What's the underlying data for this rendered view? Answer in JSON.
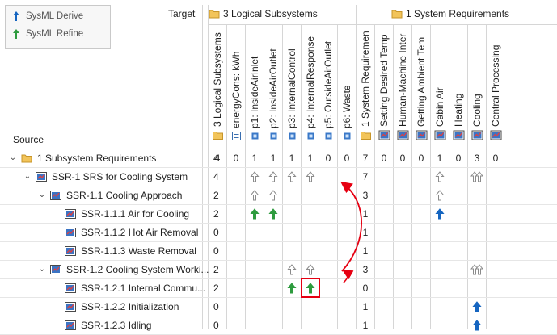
{
  "legend": {
    "items": [
      {
        "label": "SysML Derive",
        "color": "#1565c0"
      },
      {
        "label": "SysML Refine",
        "color": "#2e9b3e"
      }
    ]
  },
  "corner": {
    "target_label": "Target",
    "source_label": "Source"
  },
  "column_groups": [
    {
      "label": "3 Logical Subsystems"
    },
    {
      "label": "1 System Requirements"
    }
  ],
  "columns": [
    {
      "label": "3 Logical Subsystems",
      "icon": "folder-icon"
    },
    {
      "label": "energyCons: kWh",
      "icon": "property-icon"
    },
    {
      "label": "p1: InsideAirInlet",
      "icon": "port-icon"
    },
    {
      "label": "p2: InsideAirOutlet",
      "icon": "port-icon"
    },
    {
      "label": "p3: InternalControl",
      "icon": "port-icon"
    },
    {
      "label": "p4: InternalResponse",
      "icon": "port-icon"
    },
    {
      "label": "p5: OutsideAirOutlet",
      "icon": "port-icon"
    },
    {
      "label": "p6: Waste",
      "icon": "port-icon"
    },
    {
      "label": "1 System Requiremen",
      "icon": "folder-icon"
    },
    {
      "label": "Setting Desired Temp",
      "icon": "requirement-icon"
    },
    {
      "label": "Human-Machine Inter",
      "icon": "requirement-icon"
    },
    {
      "label": "Getting Ambient Tem",
      "icon": "requirement-icon"
    },
    {
      "label": "Cabin Air",
      "icon": "requirement-icon"
    },
    {
      "label": "Heating",
      "icon": "requirement-icon"
    },
    {
      "label": "Cooling",
      "icon": "requirement-icon"
    },
    {
      "label": "Central Processing",
      "icon": "requirement-icon"
    }
  ],
  "rows": [
    {
      "label": "1 Subsystem Requirements",
      "icon": "folder-icon",
      "expander": "v",
      "indent": 0,
      "count": "4",
      "cells": [
        "4",
        "0",
        "1",
        "1",
        "1",
        "1",
        "0",
        "0",
        "7",
        "0",
        "0",
        "0",
        "1",
        "0",
        "3",
        "0"
      ]
    },
    {
      "label": "SSR-1 SRS for Cooling System",
      "icon": "requirement-icon",
      "expander": "v",
      "indent": 1,
      "count": "4",
      "cells": [
        "",
        "",
        "up-gray",
        "up-gray",
        "up-gray",
        "up-gray",
        "",
        "",
        "7",
        "",
        "",
        "",
        "up-gray",
        "",
        "up-gray-double",
        ""
      ]
    },
    {
      "label": "SSR-1.1 Cooling Approach",
      "icon": "requirement-icon",
      "expander": "v",
      "indent": 2,
      "count": "2",
      "cells": [
        "",
        "",
        "up-gray",
        "up-gray",
        "",
        "",
        "",
        "",
        "3",
        "",
        "",
        "",
        "up-gray",
        "",
        "",
        ""
      ]
    },
    {
      "label": "SSR-1.1.1 Air for Cooling",
      "icon": "requirement-icon",
      "expander": "",
      "indent": 3,
      "count": "2",
      "cells": [
        "",
        "",
        "up-green",
        "up-green",
        "",
        "",
        "",
        "",
        "1",
        "",
        "",
        "",
        "up-blue",
        "",
        "",
        ""
      ]
    },
    {
      "label": "SSR-1.1.2 Hot Air Removal",
      "icon": "requirement-icon",
      "expander": "",
      "indent": 3,
      "count": "0",
      "cells": [
        "",
        "",
        "",
        "",
        "",
        "",
        "",
        "",
        "1",
        "",
        "",
        "",
        "",
        "",
        "",
        ""
      ]
    },
    {
      "label": "SSR-1.1.3 Waste Removal",
      "icon": "requirement-icon",
      "expander": "",
      "indent": 3,
      "count": "0",
      "cells": [
        "",
        "",
        "",
        "",
        "",
        "",
        "",
        "",
        "1",
        "",
        "",
        "",
        "",
        "",
        "",
        ""
      ]
    },
    {
      "label": "SSR-1.2 Cooling System Worki...",
      "icon": "requirement-icon",
      "expander": "v",
      "indent": 2,
      "count": "2",
      "cells": [
        "",
        "",
        "",
        "",
        "up-gray",
        "up-gray",
        "",
        "",
        "3",
        "",
        "",
        "",
        "",
        "",
        "up-gray-double",
        ""
      ]
    },
    {
      "label": "SSR-1.2.1 Internal Commu...",
      "icon": "requirement-icon",
      "expander": "",
      "indent": 3,
      "count": "2",
      "cells": [
        "",
        "",
        "",
        "",
        "up-green",
        "up-green-selected",
        "",
        "",
        "0",
        "",
        "",
        "",
        "",
        "",
        "",
        ""
      ]
    },
    {
      "label": "SSR-1.2.2 Initialization",
      "icon": "requirement-icon",
      "expander": "",
      "indent": 3,
      "count": "0",
      "cells": [
        "",
        "",
        "",
        "",
        "",
        "",
        "",
        "",
        "1",
        "",
        "",
        "",
        "",
        "",
        "up-blue",
        ""
      ]
    },
    {
      "label": "SSR-1.2.3 Idling",
      "icon": "requirement-icon",
      "expander": "",
      "indent": 3,
      "count": "0",
      "cells": [
        "",
        "",
        "",
        "",
        "",
        "",
        "",
        "",
        "1",
        "",
        "",
        "",
        "",
        "",
        "up-blue",
        ""
      ]
    }
  ]
}
